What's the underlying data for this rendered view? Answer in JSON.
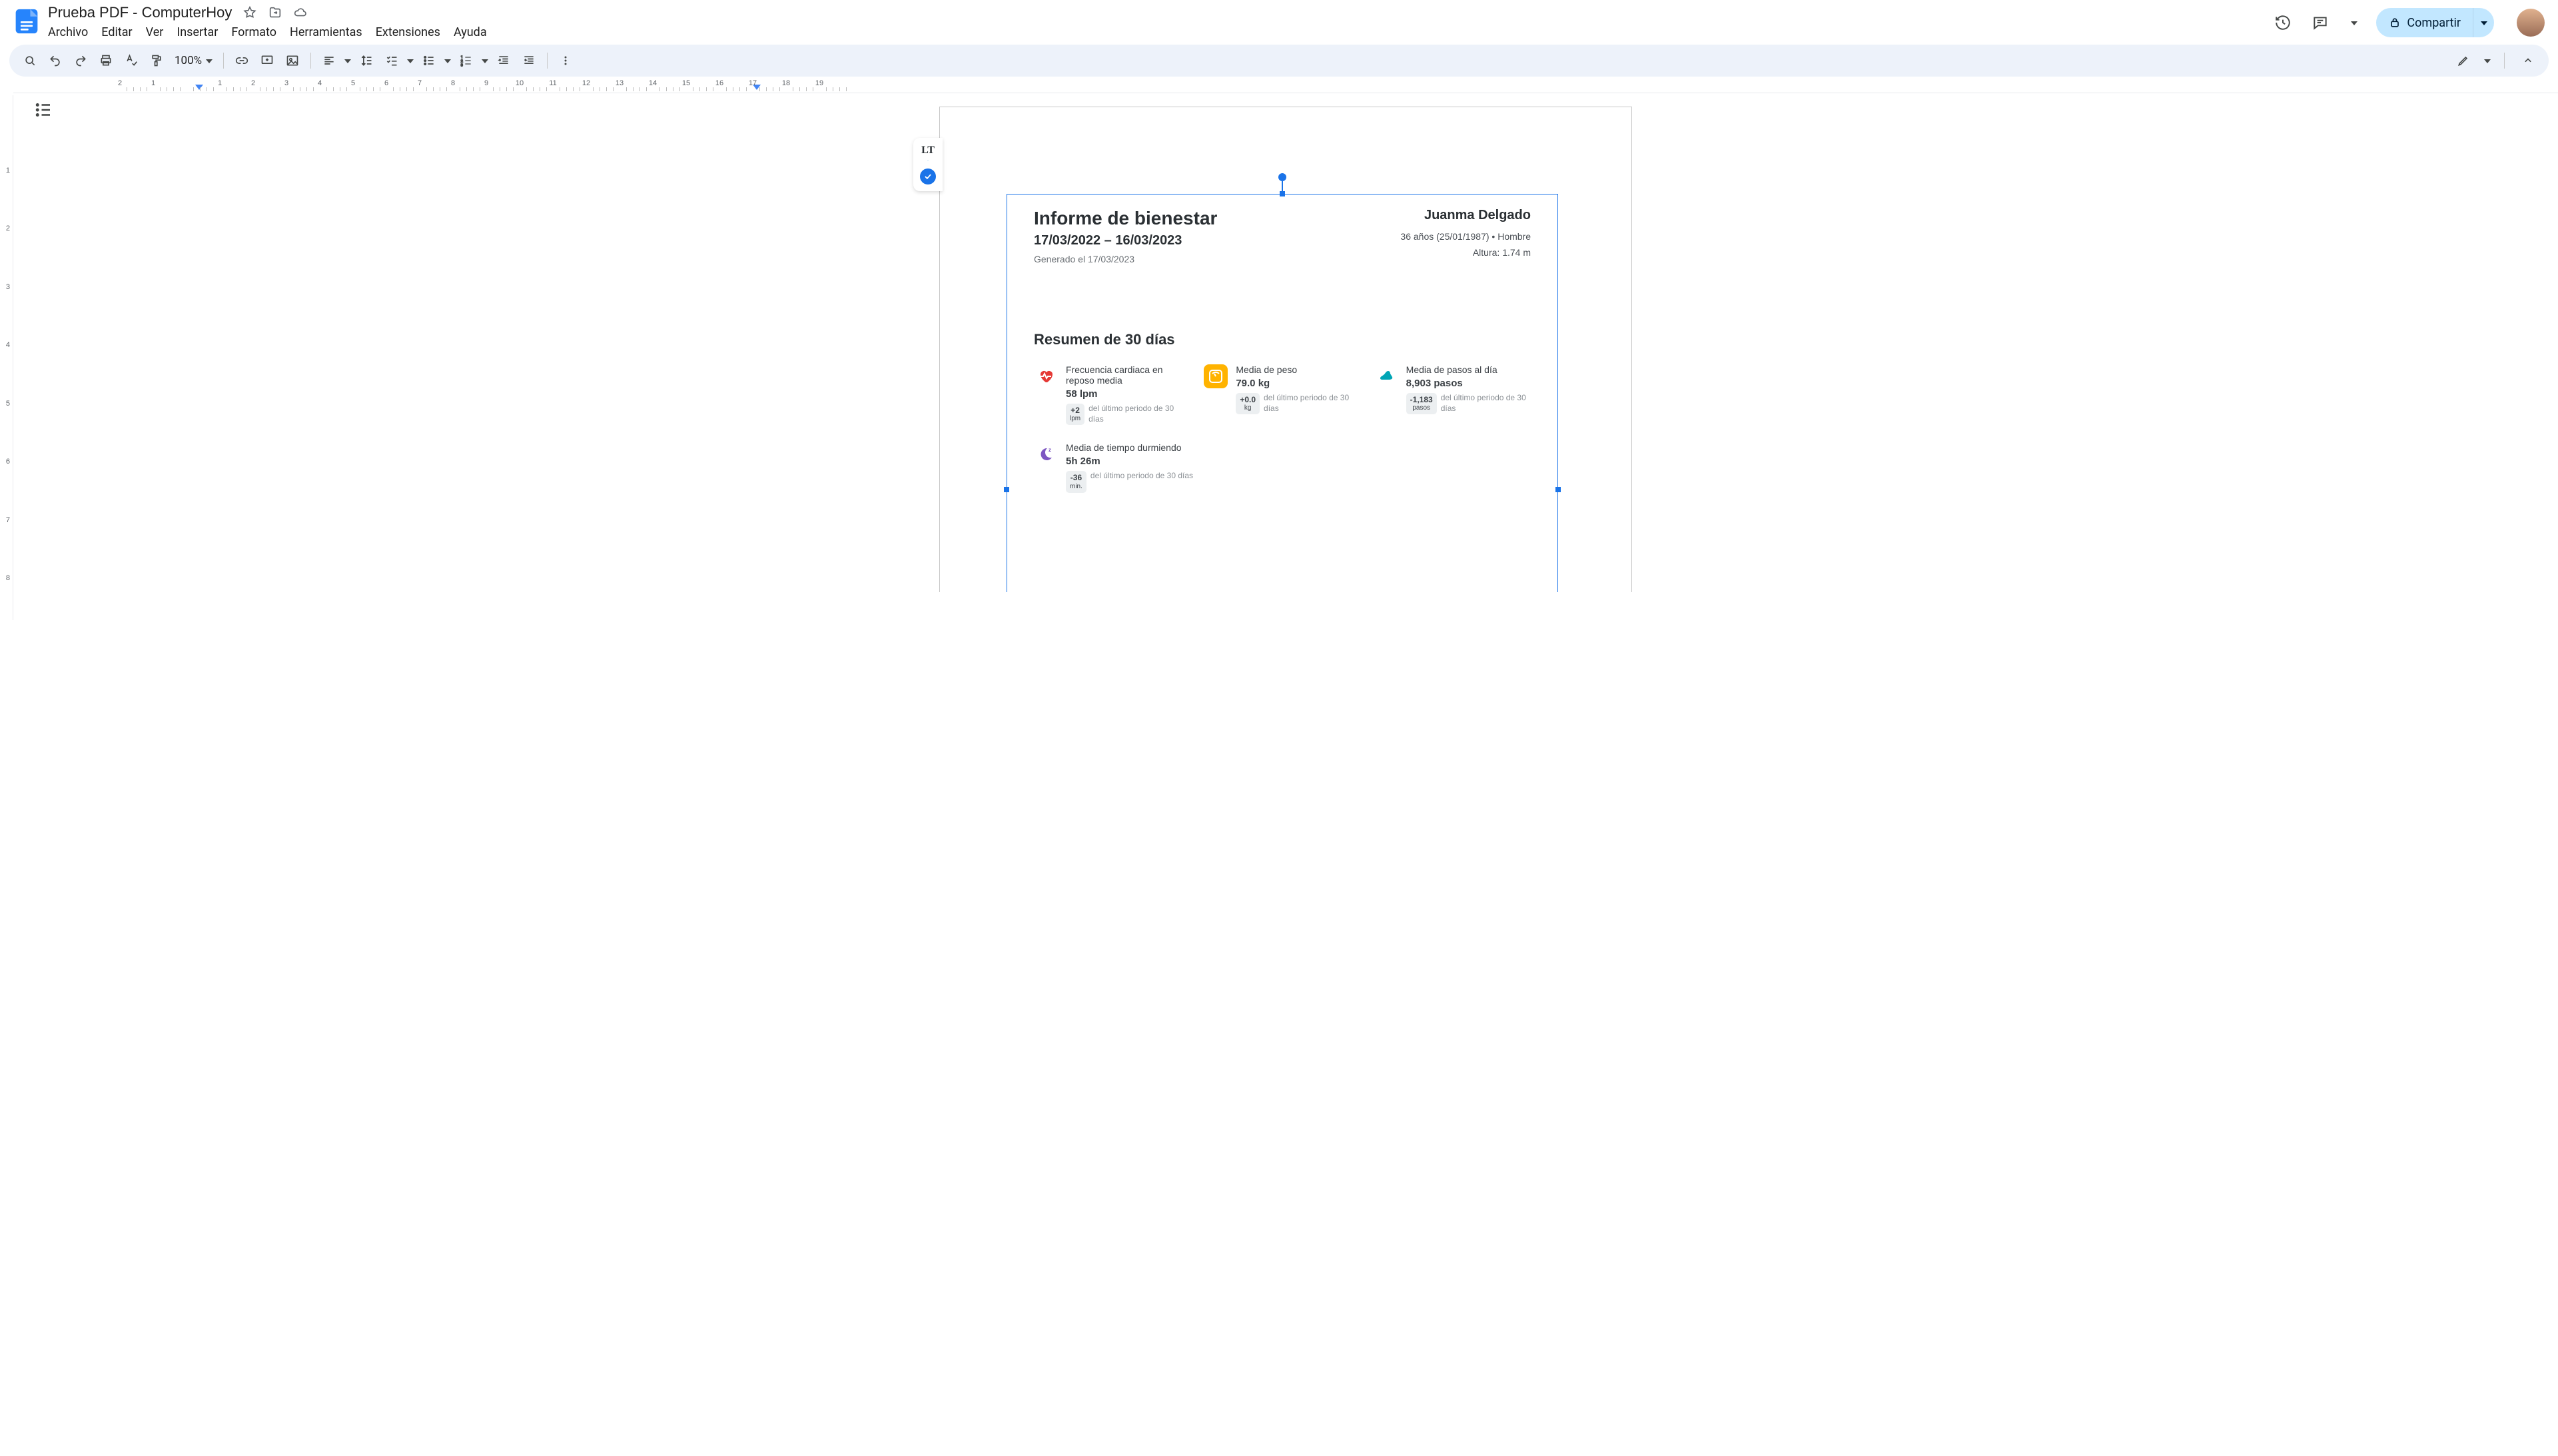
{
  "doc": {
    "title": "Prueba PDF - ComputerHoy"
  },
  "menu": [
    "Archivo",
    "Editar",
    "Ver",
    "Insertar",
    "Formato",
    "Herramientas",
    "Extensiones",
    "Ayuda"
  ],
  "share": {
    "label": "Compartir"
  },
  "zoom": "100%",
  "ruler_h_nums": [
    "2",
    "1",
    "",
    "1",
    "2",
    "3",
    "4",
    "5",
    "6",
    "7",
    "8",
    "9",
    "10",
    "11",
    "12",
    "13",
    "14",
    "15",
    "16",
    "17",
    "18",
    "19"
  ],
  "ruler_v_nums": [
    "",
    "1",
    "2",
    "3",
    "4",
    "5",
    "6",
    "7",
    "8"
  ],
  "report": {
    "title": "Informe de bienestar",
    "date_range": "17/03/2022 – 16/03/2023",
    "generated": "Generado el 17/03/2023",
    "user_name": "Juanma Delgado",
    "user_bio": "36 años (25/01/1987)  •  Hombre",
    "user_height": "Altura: 1.74 m",
    "summary_title": "Resumen de 30 días",
    "cards": {
      "hr": {
        "title": "Frecuencia cardiaca en reposo media",
        "value": "58 lpm",
        "delta": "+2",
        "delta_unit": "lpm",
        "delta_lbl": "del último periodo de 30 días"
      },
      "wt": {
        "title": "Media de peso",
        "value": "79.0 kg",
        "delta": "+0.0",
        "delta_unit": "kg",
        "delta_lbl": "del último periodo de 30 días"
      },
      "step": {
        "title": "Media de pasos al día",
        "value": "8,903 pasos",
        "delta": "-1,183",
        "delta_unit": "pasos",
        "delta_lbl": "del último periodo de 30 días"
      },
      "sleep": {
        "title": "Media de tiempo durmiendo",
        "value": "5h 26m",
        "delta": "-36",
        "delta_unit": "min.",
        "delta_lbl": "del último periodo de 30 días"
      }
    }
  }
}
